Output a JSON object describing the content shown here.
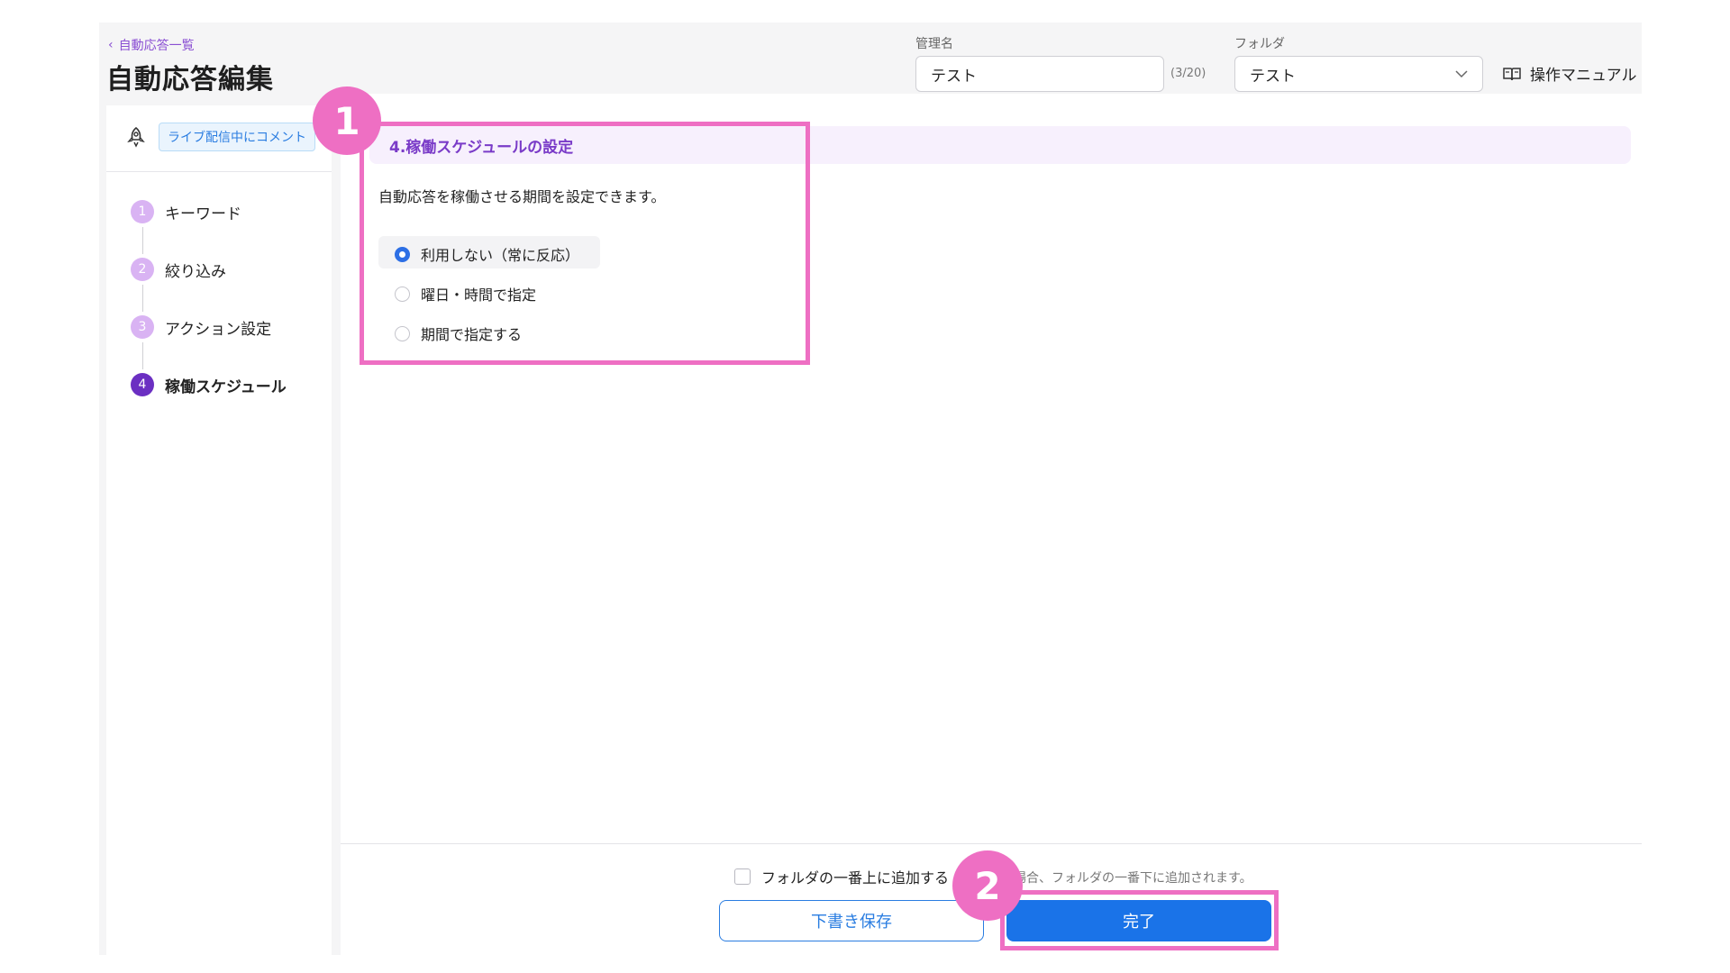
{
  "header": {
    "back_link": "自動応答一覧",
    "page_title": "自動応答編集",
    "management_name": {
      "label": "管理名",
      "value": "テスト",
      "counter": "(3/20)"
    },
    "folder": {
      "label": "フォルダ",
      "selected": "テスト"
    },
    "manual_link": "操作マニュアル"
  },
  "sidebar": {
    "trigger_badge": "ライブ配信中にコメント",
    "steps": [
      {
        "num": "1",
        "label": "キーワード"
      },
      {
        "num": "2",
        "label": "絞り込み"
      },
      {
        "num": "3",
        "label": "アクション設定"
      },
      {
        "num": "4",
        "label": "稼働スケジュール"
      }
    ]
  },
  "main": {
    "section_title": "4.稼働スケジュールの設定",
    "description": "自動応答を稼働させる期間を設定できます。",
    "options": [
      {
        "label": "利用しない（常に反応）",
        "checked": true
      },
      {
        "label": "曜日・時間で指定",
        "checked": false
      },
      {
        "label": "期間で指定する",
        "checked": false
      }
    ]
  },
  "footer": {
    "checkbox_label": "フォルダの一番上に追加する",
    "note": "場合、フォルダの一番下に追加されます。",
    "draft_button": "下書き保存",
    "done_button": "完了"
  },
  "annotations": {
    "marker1": "1",
    "marker2": "2"
  },
  "colors": {
    "accent_purple": "#7a3bc8",
    "primary_blue": "#1a73e8",
    "highlight_pink": "#ee6fc3"
  }
}
